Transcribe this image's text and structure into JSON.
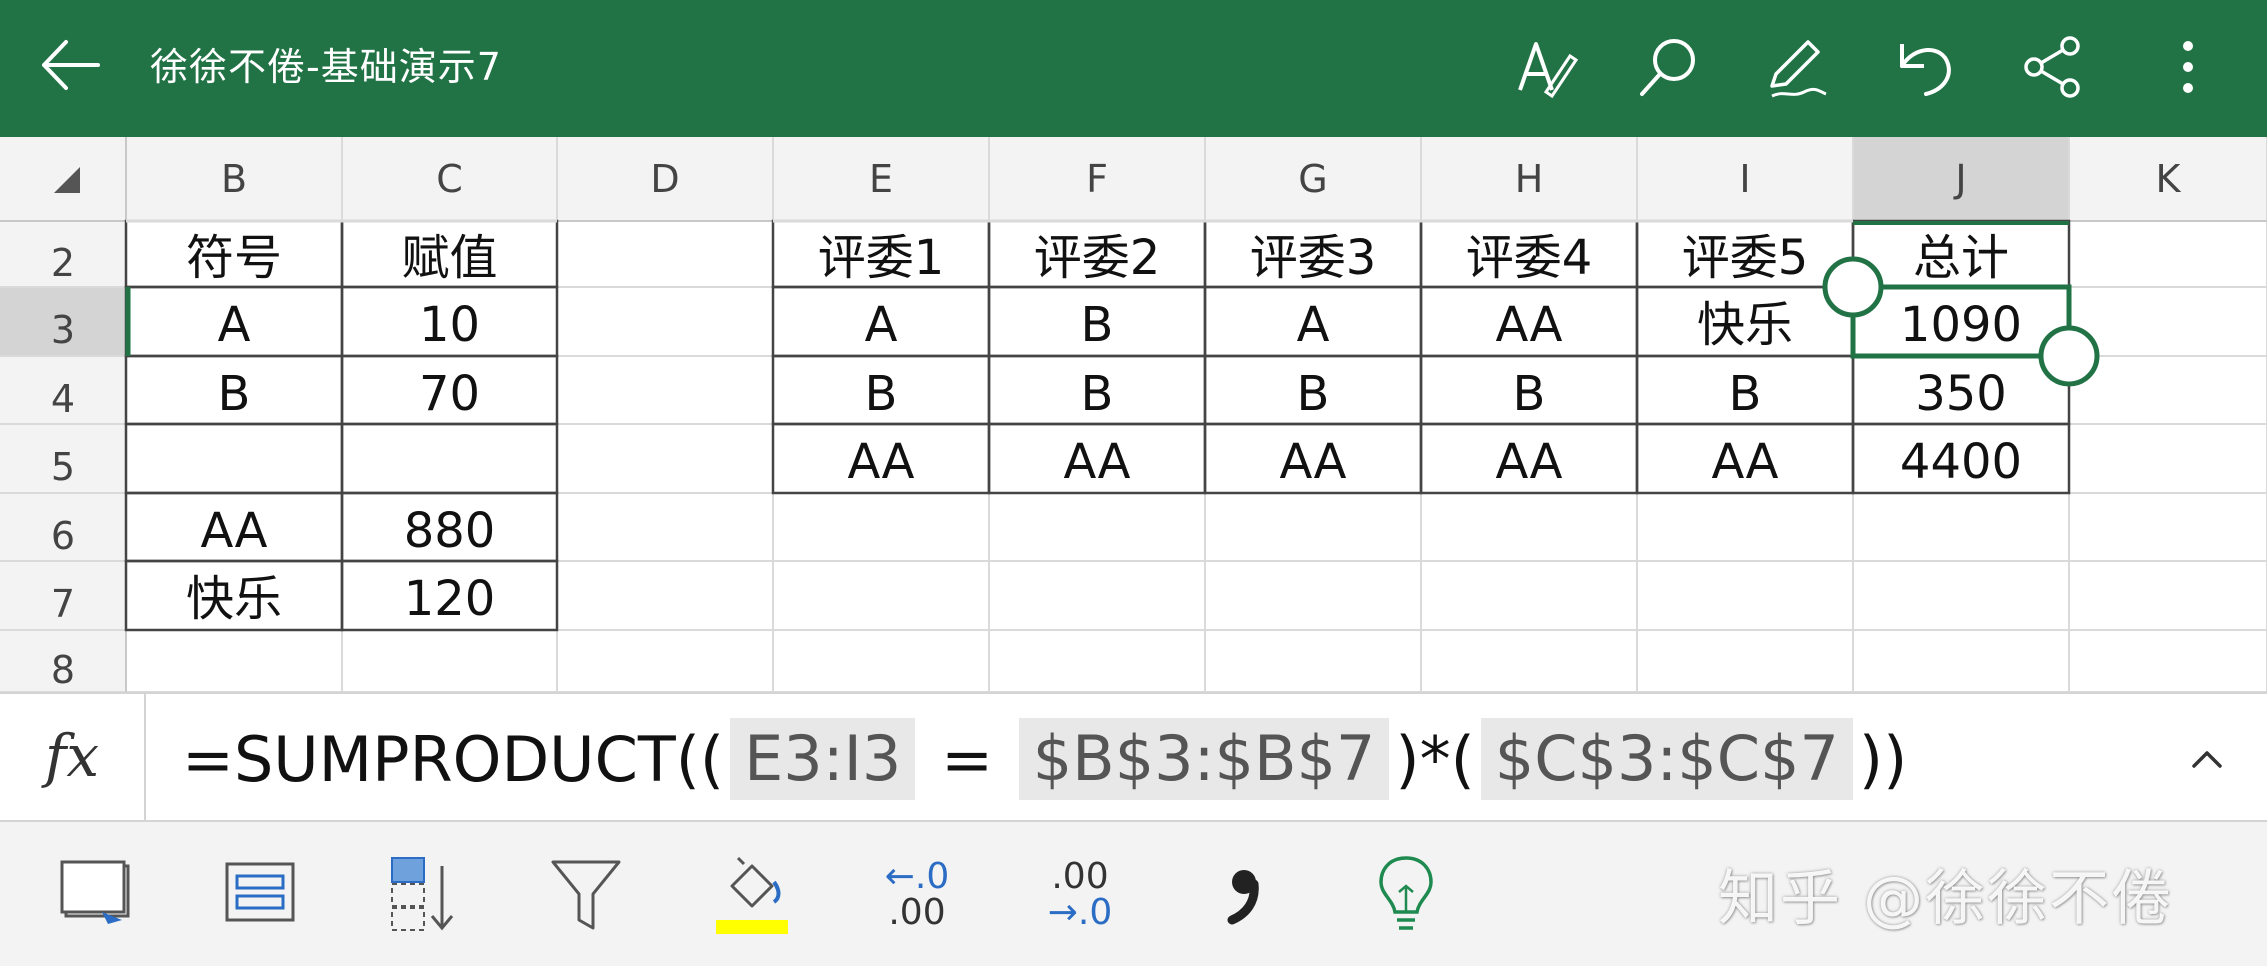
{
  "app": {
    "document_title": "徐徐不倦-基础演示7",
    "accent_color": "#217346"
  },
  "titlebar_buttons": [
    {
      "name": "text-format-icon"
    },
    {
      "name": "search-icon"
    },
    {
      "name": "pen-icon"
    },
    {
      "name": "undo-icon"
    },
    {
      "name": "share-icon"
    },
    {
      "name": "more-icon"
    }
  ],
  "columns": [
    "B",
    "C",
    "D",
    "E",
    "F",
    "G",
    "H",
    "I",
    "J",
    "K"
  ],
  "selected_column": "J",
  "rows": [
    "2",
    "3",
    "4",
    "5",
    "6",
    "7",
    "8"
  ],
  "selected_row": "3",
  "cells": {
    "B2": "符号",
    "C2": "赋值",
    "B3": "A",
    "C3": "10",
    "B4": "B",
    "C4": "70",
    "B6": "AA",
    "C6": "880",
    "B7": "快乐",
    "C7": "120",
    "E2": "评委1",
    "F2": "评委2",
    "G2": "评委3",
    "H2": "评委4",
    "I2": "评委5",
    "J2": "总计",
    "E3": "A",
    "F3": "B",
    "G3": "A",
    "H3": "AA",
    "I3": "快乐",
    "J3": "1090",
    "E4": "B",
    "F4": "B",
    "G4": "B",
    "H4": "B",
    "I4": "B",
    "J4": "350",
    "E5": "AA",
    "F5": "AA",
    "G5": "AA",
    "H5": "AA",
    "I5": "AA",
    "J5": "4400"
  },
  "formula_bar": {
    "fx_label": "fx",
    "parts": [
      "=SUMPRODUCT((",
      "E3:I3",
      " = ",
      "$B$3:$B$7",
      ")*(",
      "$C$3:$C$7",
      "))"
    ]
  },
  "toolbar": {
    "tools": [
      "freeze-panes-icon",
      "wrap-text-icon",
      "sort-icon",
      "filter-icon",
      "fill-color-icon",
      "decrease-decimal-icon",
      "increase-decimal-icon",
      "comma-style-icon",
      "ideas-lightbulb-icon"
    ],
    "decrease_decimal": {
      "top": "←.0",
      "bottom": ".00"
    },
    "increase_decimal": {
      "top": ".00",
      "bottom": "→.0"
    },
    "fill_color": "#ffff00",
    "watermark": "知乎 @徐徐不倦"
  }
}
